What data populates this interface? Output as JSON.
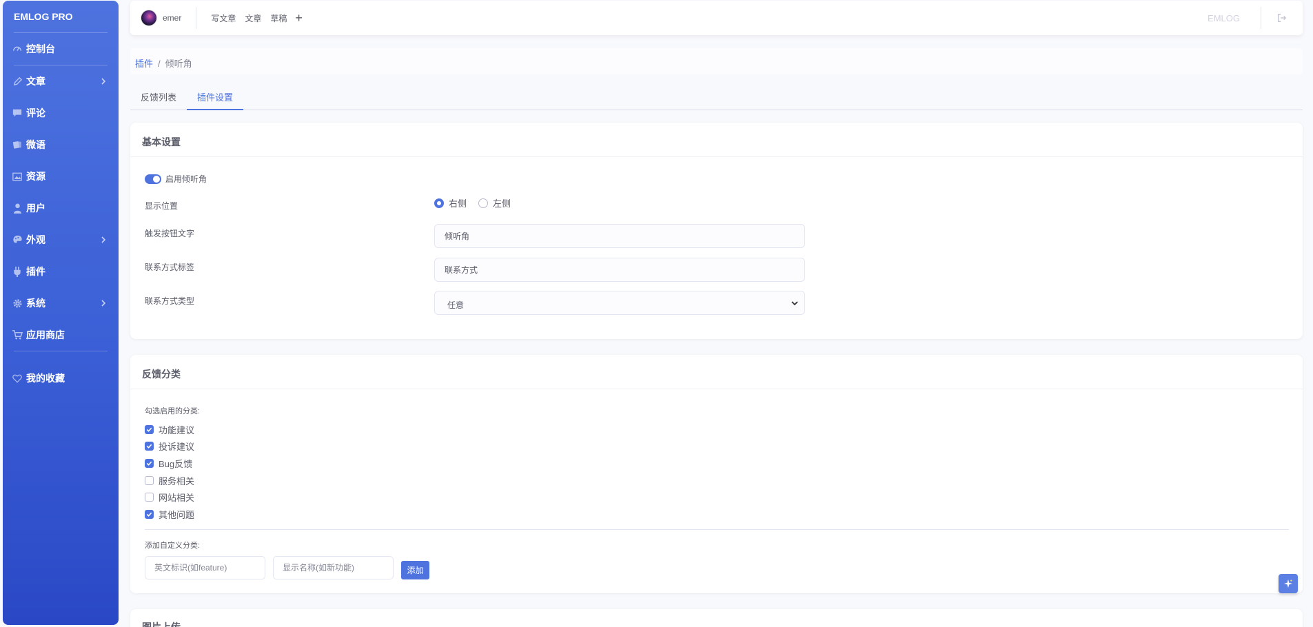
{
  "sidebar": {
    "brand": "EMLOG PRO",
    "items": [
      {
        "label": "控制台"
      },
      {
        "label": "文章"
      },
      {
        "label": "评论"
      },
      {
        "label": "微语"
      },
      {
        "label": "资源"
      },
      {
        "label": "用户"
      },
      {
        "label": "外观"
      },
      {
        "label": "插件"
      },
      {
        "label": "系统"
      },
      {
        "label": "应用商店"
      }
    ],
    "favorites": "我的收藏"
  },
  "topbar": {
    "username": "emer",
    "links": [
      "写文章",
      "文章",
      "草稿"
    ],
    "plus": "+",
    "brand": "EMLOG"
  },
  "breadcrumb": {
    "parent": "插件",
    "separator": "/",
    "current": "倾听角"
  },
  "tabs": [
    {
      "label": "反馈列表"
    },
    {
      "label": "插件设置"
    }
  ],
  "basic": {
    "title": "基本设置",
    "enable_label": "启用倾听角",
    "position_label": "显示位置",
    "position_options": [
      "右侧",
      "左侧"
    ],
    "trigger_label": "触发按钮文字",
    "trigger_value": "倾听角",
    "contact_label": "联系方式标签",
    "contact_value": "联系方式",
    "contact_type_label": "联系方式类型",
    "contact_type_value": "任意"
  },
  "categories": {
    "title": "反馈分类",
    "select_hint": "勾选启用的分类:",
    "items": [
      {
        "label": "功能建议",
        "checked": true
      },
      {
        "label": "投诉建议",
        "checked": true
      },
      {
        "label": "Bug反馈",
        "checked": true
      },
      {
        "label": "服务相关",
        "checked": false
      },
      {
        "label": "网站相关",
        "checked": false
      },
      {
        "label": "其他问题",
        "checked": true
      }
    ],
    "add_hint": "添加自定义分类:",
    "key_placeholder": "英文标识(如feature)",
    "name_placeholder": "显示名称(如新功能)",
    "add_button": "添加"
  },
  "upload": {
    "title": "图片上传"
  },
  "colors": {
    "primary": "#4e73df",
    "text": "#5a5c69"
  }
}
